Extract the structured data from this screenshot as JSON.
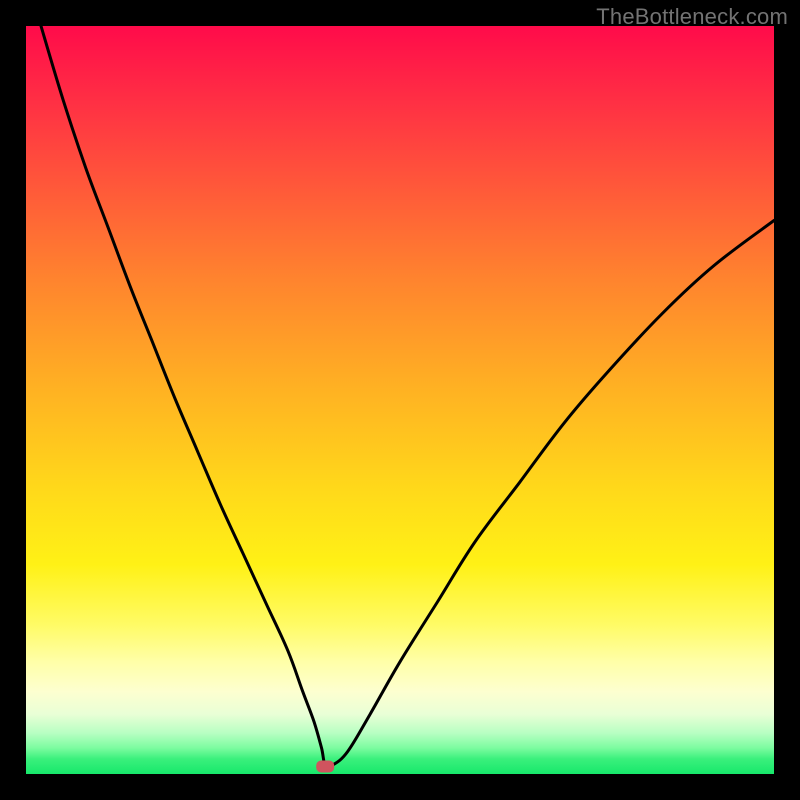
{
  "watermark": "TheBottleneck.com",
  "chart_data": {
    "type": "line",
    "title": "",
    "xlabel": "",
    "ylabel": "",
    "xlim": [
      0,
      100
    ],
    "ylim": [
      0,
      100
    ],
    "grid": false,
    "legend": false,
    "background": "red-to-green vertical gradient",
    "marker": {
      "x": 40,
      "y": 1,
      "color": "#d0545e",
      "shape": "rounded-rect"
    },
    "series": [
      {
        "name": "curve",
        "color": "#000000",
        "x": [
          2,
          5,
          8,
          11,
          14,
          17,
          20,
          23,
          26,
          29,
          32,
          35,
          37,
          38.5,
          39.5,
          40,
          41,
          43,
          46,
          50,
          55,
          60,
          66,
          72,
          78,
          85,
          92,
          100
        ],
        "y": [
          100,
          90,
          81,
          73,
          65,
          57.5,
          50,
          43,
          36,
          29.5,
          23,
          16.5,
          11,
          7,
          3.5,
          1.2,
          1.2,
          3,
          8,
          15,
          23,
          31,
          39,
          47,
          54,
          61.5,
          68,
          74
        ]
      }
    ]
  }
}
